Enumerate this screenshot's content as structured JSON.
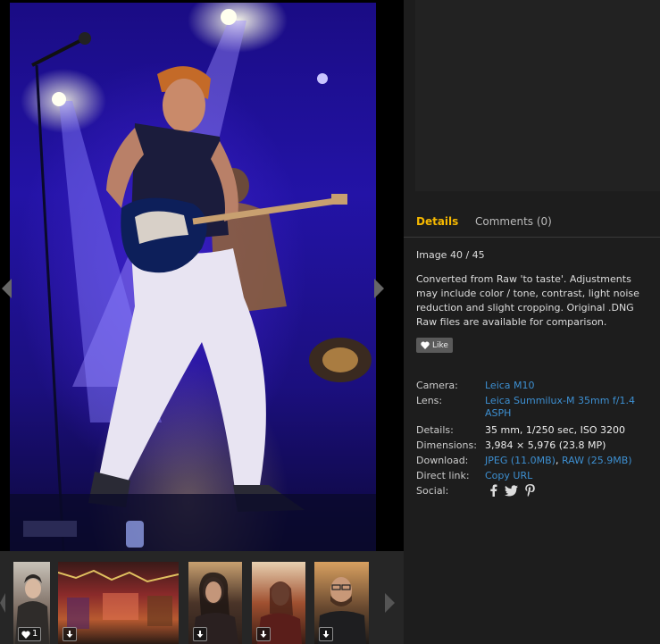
{
  "details": {
    "tabs": {
      "details": "Details",
      "comments": "Comments (0)"
    },
    "counter": "Image 40 / 45",
    "description": "Converted from Raw 'to taste'. Adjustments may include color / tone, contrast, light noise reduction and slight cropping. Original .DNG Raw files are available for comparison.",
    "like_label": "Like",
    "meta": {
      "camera_label": "Camera:",
      "camera_value": "Leica M10",
      "lens_label": "Lens:",
      "lens_value_1": "Leica Summilux-M 35mm f/1.4",
      "lens_value_2": "ASPH",
      "details_label": "Details:",
      "details_value": "35 mm, 1/250 sec, ISO 3200",
      "dimensions_label": "Dimensions:",
      "dimensions_value": "3,984 × 5,976 (23.8 MP)",
      "download_label": "Download:",
      "download_jpeg": "JPEG (11.0MB)",
      "download_sep": ",",
      "download_raw": "RAW (25.9MB)",
      "direct_link_label": "Direct link:",
      "direct_link_value": "Copy URL",
      "social_label": "Social:"
    }
  },
  "social_icons": [
    "facebook-icon",
    "twitter-icon",
    "pinterest-icon"
  ],
  "thumbnails": [
    {
      "name": "thumb-woman-coat",
      "badge": "1",
      "badge_icon": "heart-icon"
    },
    {
      "name": "thumb-market",
      "badge": "",
      "badge_icon": "download-icon"
    },
    {
      "name": "thumb-woman-dark-hair",
      "badge": "",
      "badge_icon": "download-icon"
    },
    {
      "name": "thumb-woman-bar",
      "badge": "",
      "badge_icon": "download-icon"
    },
    {
      "name": "thumb-man-beard",
      "badge": "",
      "badge_icon": "download-icon"
    }
  ],
  "colors": {
    "accent": "#f5b800",
    "link": "#3d8fd1",
    "panel": "#1d1d1d"
  }
}
